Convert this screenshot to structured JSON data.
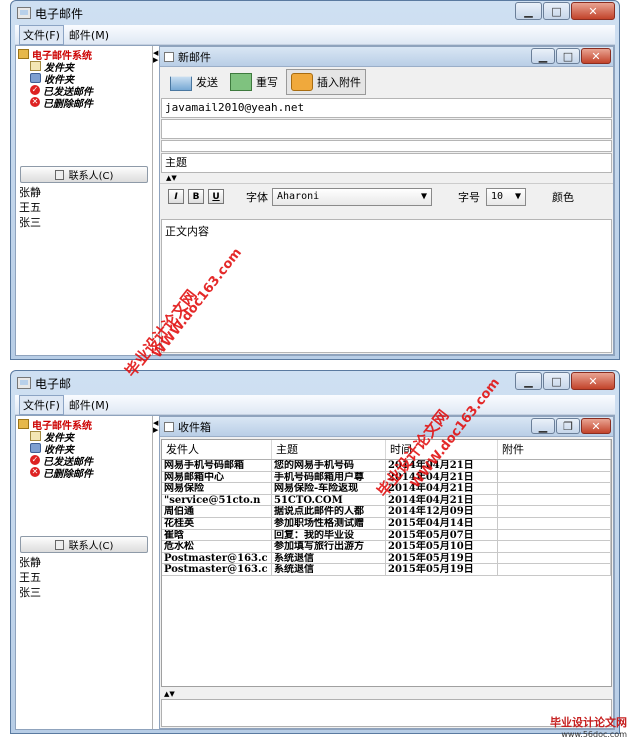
{
  "window1": {
    "title": "电子邮件",
    "menus": [
      "文件(F)",
      "邮件(M)"
    ],
    "tree": {
      "root": "电子邮件系统",
      "items": [
        "发件夹",
        "收件夹",
        "已发送邮件",
        "已删除邮件"
      ]
    },
    "contacts_button": "联系人(C)",
    "contacts": [
      "张静",
      "王五",
      "张三"
    ],
    "compose": {
      "title": "新邮件",
      "send_label": "发送",
      "rewrite_label": "重写",
      "attach_label": "插入附件",
      "to_value": "javamail2010@yeah.net",
      "subject_value": "主题",
      "bold": "B",
      "italic": "I",
      "underline": "U",
      "font_label": "字体",
      "font_value": "Aharoni",
      "size_label": "字号",
      "size_value": "10",
      "color_label": "颜色",
      "body_value": "正文内容"
    }
  },
  "window2": {
    "title": "电子邮",
    "menus": [
      "文件(F)",
      "邮件(M)"
    ],
    "tree": {
      "root": "电子邮件系统",
      "items": [
        "发件夹",
        "收件夹",
        "已发送邮件",
        "已删除邮件"
      ]
    },
    "contacts_button": "联系人(C)",
    "contacts": [
      "张静",
      "王五",
      "张三"
    ],
    "inbox": {
      "title": "收件箱",
      "columns": [
        "发件人",
        "主题",
        "时间",
        "附件"
      ],
      "rows": [
        [
          "网易手机号码邮箱",
          "您的网易手机号码",
          "2014年04月21日",
          ""
        ],
        [
          "网易邮箱中心",
          "手机号码邮箱用户尊",
          "2014年04月21日",
          ""
        ],
        [
          "网易保险",
          "网易保险-车险返现",
          "2014年04月21日",
          ""
        ],
        [
          "\"service@51cto.n",
          "51CTO.COM",
          "2014年04月21日",
          ""
        ],
        [
          "周伯通",
          "据说点此邮件的人都",
          "2014年12月09日",
          ""
        ],
        [
          "花桂英",
          "参加职场性格测试赠",
          "2015年04月14日",
          ""
        ],
        [
          "崔晗",
          "回复：我的毕业设",
          "2015年05月07日",
          ""
        ],
        [
          "危水松",
          "参加填写旅行出游方",
          "2015年05月10日",
          ""
        ],
        [
          "Postmaster@163.c",
          "系统退信",
          "2015年05月19日",
          ""
        ],
        [
          "Postmaster@163.c",
          "系统退信",
          "2015年05月19日",
          ""
        ]
      ]
    }
  },
  "watermarks": {
    "cn": "毕业设计论文网",
    "url": "WWW.doc163.com",
    "footer_cn": "毕业设计论文网",
    "footer_url": "www.56doc.com"
  }
}
